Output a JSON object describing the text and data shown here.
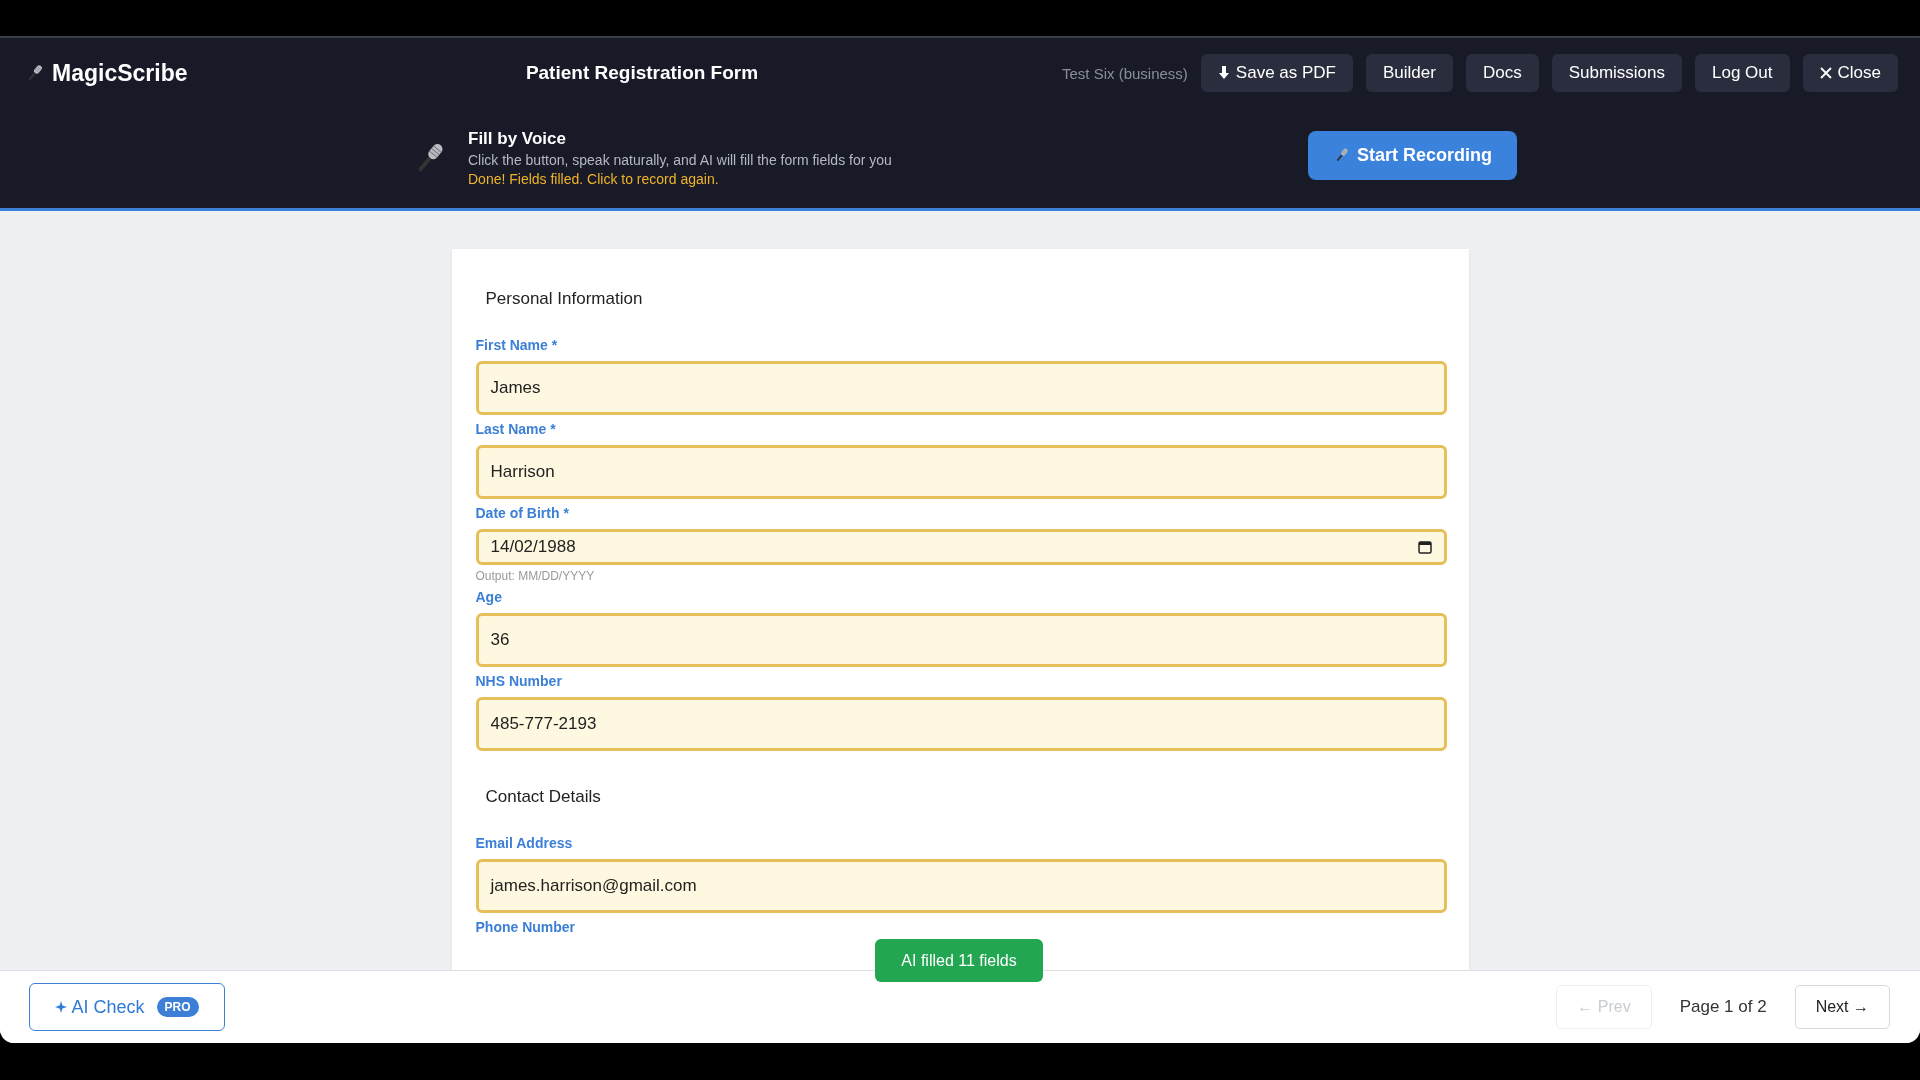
{
  "app": {
    "name": "MagicScribe",
    "form_title": "Patient Registration Form",
    "account": "Test Six (business)"
  },
  "nav_buttons": [
    {
      "kind": "download",
      "label": "Save as PDF"
    },
    {
      "kind": "plain",
      "label": "Builder"
    },
    {
      "kind": "plain",
      "label": "Docs"
    },
    {
      "kind": "plain",
      "label": "Submissions"
    },
    {
      "kind": "plain",
      "label": "Log Out"
    },
    {
      "kind": "close",
      "label": "Close"
    }
  ],
  "voice": {
    "title": "Fill by Voice",
    "description": "Click the button, speak naturally, and AI will fill the form fields for you",
    "status": "Done! Fields filled. Click to record again.",
    "button": "Start Recording"
  },
  "sections": [
    {
      "title": "Personal Information",
      "fields": [
        {
          "kind": "text",
          "label": "First Name *",
          "value": "James",
          "ai_filled": true
        },
        {
          "kind": "text",
          "label": "Last Name *",
          "value": "Harrison",
          "ai_filled": true
        },
        {
          "kind": "date",
          "label": "Date of Birth *",
          "value": "14/02/1988",
          "hint": "Output: MM/DD/YYYY",
          "ai_filled": true
        },
        {
          "kind": "text",
          "label": "Age",
          "value": "36",
          "ai_filled": true
        },
        {
          "kind": "text",
          "label": "NHS Number",
          "value": "485-777-2193",
          "ai_filled": true
        }
      ]
    },
    {
      "title": "Contact Details",
      "fields": [
        {
          "kind": "text",
          "label": "Email Address",
          "value": "james.harrison@gmail.com",
          "ai_filled": true
        },
        {
          "kind": "label_only",
          "label": "Phone Number"
        }
      ]
    }
  ],
  "toast": "AI filled 11 fields",
  "footer": {
    "ai_check": "AI Check",
    "badge": "PRO",
    "prev": {
      "label": "← Prev",
      "disabled": true
    },
    "page": "Page 1 of 2",
    "next": {
      "label": "Next →",
      "disabled": false
    }
  }
}
